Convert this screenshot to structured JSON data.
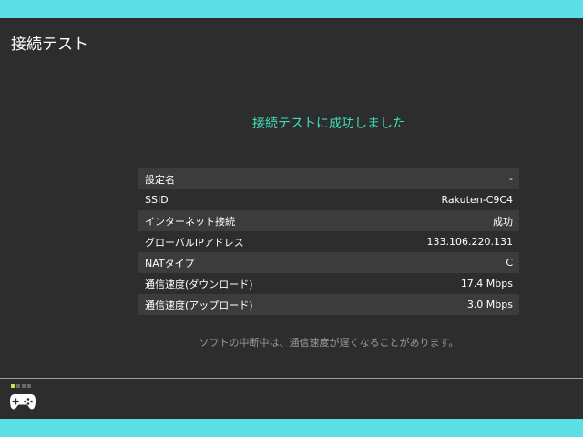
{
  "header": {
    "title": "接続テスト"
  },
  "result": {
    "message": "接続テストに成功しました"
  },
  "info_rows": [
    {
      "label": "設定名",
      "value": "-"
    },
    {
      "label": "SSID",
      "value": "Rakuten-C9C4"
    },
    {
      "label": "インターネット接続",
      "value": "成功"
    },
    {
      "label": "グローバルIPアドレス",
      "value": "133.106.220.131"
    },
    {
      "label": "NATタイプ",
      "value": "C"
    },
    {
      "label": "通信速度(ダウンロード)",
      "value": "17.4 Mbps"
    },
    {
      "label": "通信速度(アップロード)",
      "value": "3.0 Mbps"
    }
  ],
  "notice": "ソフトの中断中は、通信速度が遅くなることがあります。",
  "footer": {
    "controller_icon": "controller-icon",
    "player_indicator_active": 1,
    "player_indicator_total": 4
  },
  "colors": {
    "background": "#2d2d2d",
    "accent_success": "#40ddb9",
    "frame": "#5ce0e6",
    "player_indicator": "#b9e84a"
  }
}
